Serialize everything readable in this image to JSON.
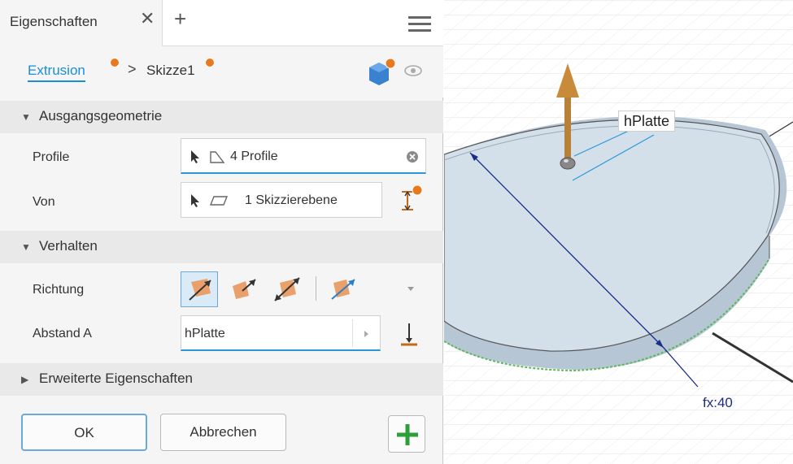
{
  "panel": {
    "tab_title": "Eigenschaften",
    "close_glyph": "✕",
    "add_glyph": "+",
    "breadcrumb": {
      "first": "Extrusion",
      "separator": ">",
      "second": "Skizze1"
    },
    "sections": {
      "input_geometry": "Ausgangsgeometrie",
      "behavior": "Verhalten",
      "advanced": "Erweiterte Eigenschaften"
    },
    "rows": {
      "profiles_label": "Profile",
      "profiles_value": "4 Profile",
      "from_label": "Von",
      "from_value": "1 Skizzierebene",
      "direction_label": "Richtung",
      "distance_label": "Abstand A",
      "distance_value": "hPlatte"
    },
    "buttons": {
      "ok": "OK",
      "cancel": "Abbrechen"
    }
  },
  "viewport": {
    "dimension_tag": "hPlatte",
    "annotation": "fx:40"
  },
  "colors": {
    "accent": "#1a8fd6",
    "warning_dot": "#e8791f",
    "add_green": "#2e9e3a",
    "disc_fill": "#cfdce8",
    "arrow_orange": "#c98a3a"
  }
}
